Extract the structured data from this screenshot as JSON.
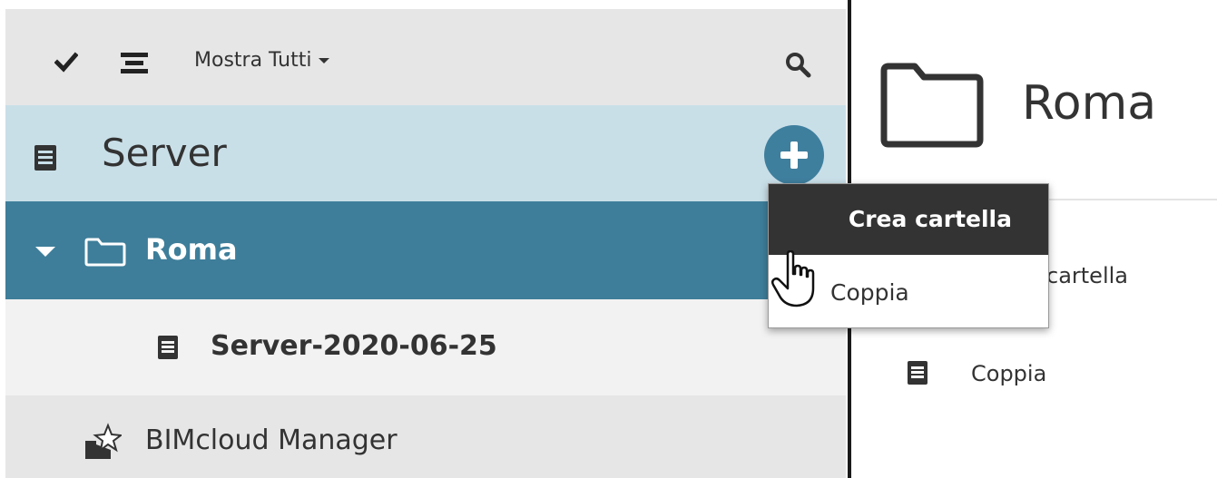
{
  "toolbar": {
    "filter_label": "Mostra Tutti",
    "icons": [
      "checkmark-icon",
      "list-icon",
      "search-icon"
    ]
  },
  "tree": {
    "root": {
      "label": "Server",
      "icon": "server-icon"
    },
    "folder": {
      "label": "Roma",
      "icon": "folder-icon",
      "expanded": true,
      "selected": true
    },
    "child": {
      "label": "Server-2020-06-25",
      "icon": "server-icon"
    },
    "manager": {
      "label": "BIMcloud Manager",
      "icon": "bimcloud-manager-icon"
    }
  },
  "add_menu": {
    "items": [
      {
        "label": "Crea cartella",
        "highlighted": true
      },
      {
        "label": "Coppia",
        "highlighted": false
      }
    ]
  },
  "detail": {
    "title": "Roma",
    "item1_label": "cartella",
    "item2_label": "Coppia"
  },
  "colors": {
    "toolbar_bg": "#e6e6e6",
    "server_row_bg": "#c9dfe8",
    "selected_row_bg": "#3e7e9a",
    "add_button": "#3f7f9e",
    "menu_highlight": "#333333"
  }
}
